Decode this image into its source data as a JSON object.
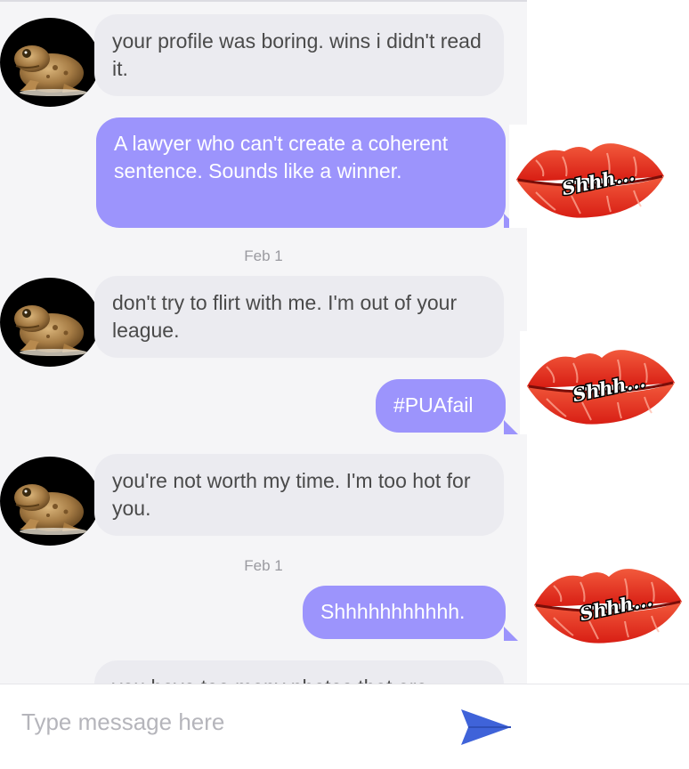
{
  "messages": [
    {
      "type": "received",
      "text": "your profile was boring. wins i didn't read it."
    },
    {
      "type": "sent",
      "text": "A lawyer who can't create a coherent sentence. Sounds like a winner."
    },
    {
      "type": "date",
      "text": "Feb 1"
    },
    {
      "type": "received",
      "text": "don't try to flirt with me. I'm out of your league."
    },
    {
      "type": "sent",
      "text": "#PUAfail"
    },
    {
      "type": "received",
      "text": "you're not worth my time. I'm too hot for you."
    },
    {
      "type": "date",
      "text": "Feb 1"
    },
    {
      "type": "sent",
      "text": "Shhhhhhhhhhh."
    },
    {
      "type": "received",
      "text": "you have too many photos that are"
    }
  ],
  "sticker_text": "Shhh...",
  "input": {
    "placeholder": "Type message here"
  },
  "colors": {
    "sent_bubble": "#9c94fc",
    "received_bubble": "#ebebf0",
    "send_icon": "#3f63d9",
    "lips": "#e8281e"
  },
  "icons": {
    "avatar": "toad-avatar-icon",
    "send": "send-arrow-icon",
    "sticker": "lips-sticker-icon"
  }
}
